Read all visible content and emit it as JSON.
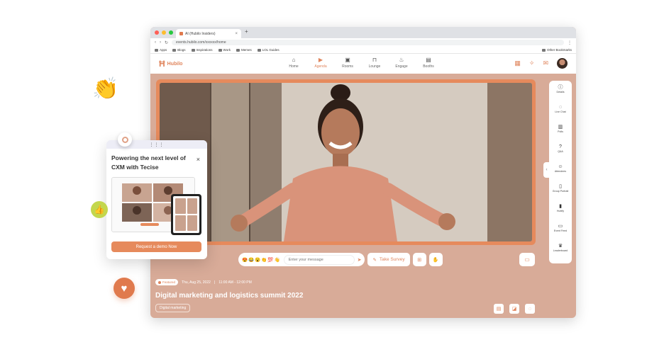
{
  "browser": {
    "tab_title": "AI (Hubilo Insiders)",
    "new_tab": "+",
    "url": "events.hubilo.com/xxxxxx/home",
    "bookmarks": [
      "Apps",
      "Blogs",
      "Inspirations",
      "Work",
      "Memes",
      "LOL Guides"
    ],
    "other_bookmarks": "Other Bookmarks"
  },
  "app": {
    "logo_text": "Hubilo",
    "nav": [
      {
        "label": "Home",
        "icon": "home-icon",
        "active": false
      },
      {
        "label": "Agenda",
        "icon": "video-icon",
        "active": true
      },
      {
        "label": "Rooms",
        "icon": "rooms-icon",
        "active": false
      },
      {
        "label": "Lounge",
        "icon": "lounge-icon",
        "active": false
      },
      {
        "label": "Engage",
        "icon": "engage-icon",
        "active": false
      },
      {
        "label": "Booths",
        "icon": "booths-icon",
        "active": false
      }
    ],
    "accent": "#e0855d"
  },
  "sidebar": {
    "items": [
      {
        "label": "Details",
        "icon": "info-icon"
      },
      {
        "label": "Live Chat",
        "icon": "chat-icon"
      },
      {
        "label": "Polls",
        "icon": "poll-icon"
      },
      {
        "label": "Q&A",
        "icon": "qa-icon"
      },
      {
        "label": "Attendees",
        "icon": "attendees-icon"
      },
      {
        "label": "Group Portrait",
        "icon": "portrait-icon"
      },
      {
        "label": "Hubify",
        "icon": "audio-icon"
      },
      {
        "label": "Event Feed",
        "icon": "feed-icon"
      },
      {
        "label": "Leaderboard",
        "icon": "trophy-icon"
      }
    ]
  },
  "chat": {
    "emojis": [
      "😍",
      "😂",
      "😮",
      "👏",
      "💯",
      "👋"
    ],
    "placeholder": "Enter your message",
    "survey_label": "Take Survey"
  },
  "session": {
    "badge": "Featured",
    "date": "Thu, Aug 25, 2022",
    "time": "11:00 AM - 12:00 PM",
    "title": "Digital marketing and logistics summit 2022",
    "tag": "Digital marketing"
  },
  "popup": {
    "handle": "⋮⋮⋮",
    "title": "Powering the next level of CXM with Tecise",
    "close": "×",
    "button": "Request a demo Now"
  }
}
